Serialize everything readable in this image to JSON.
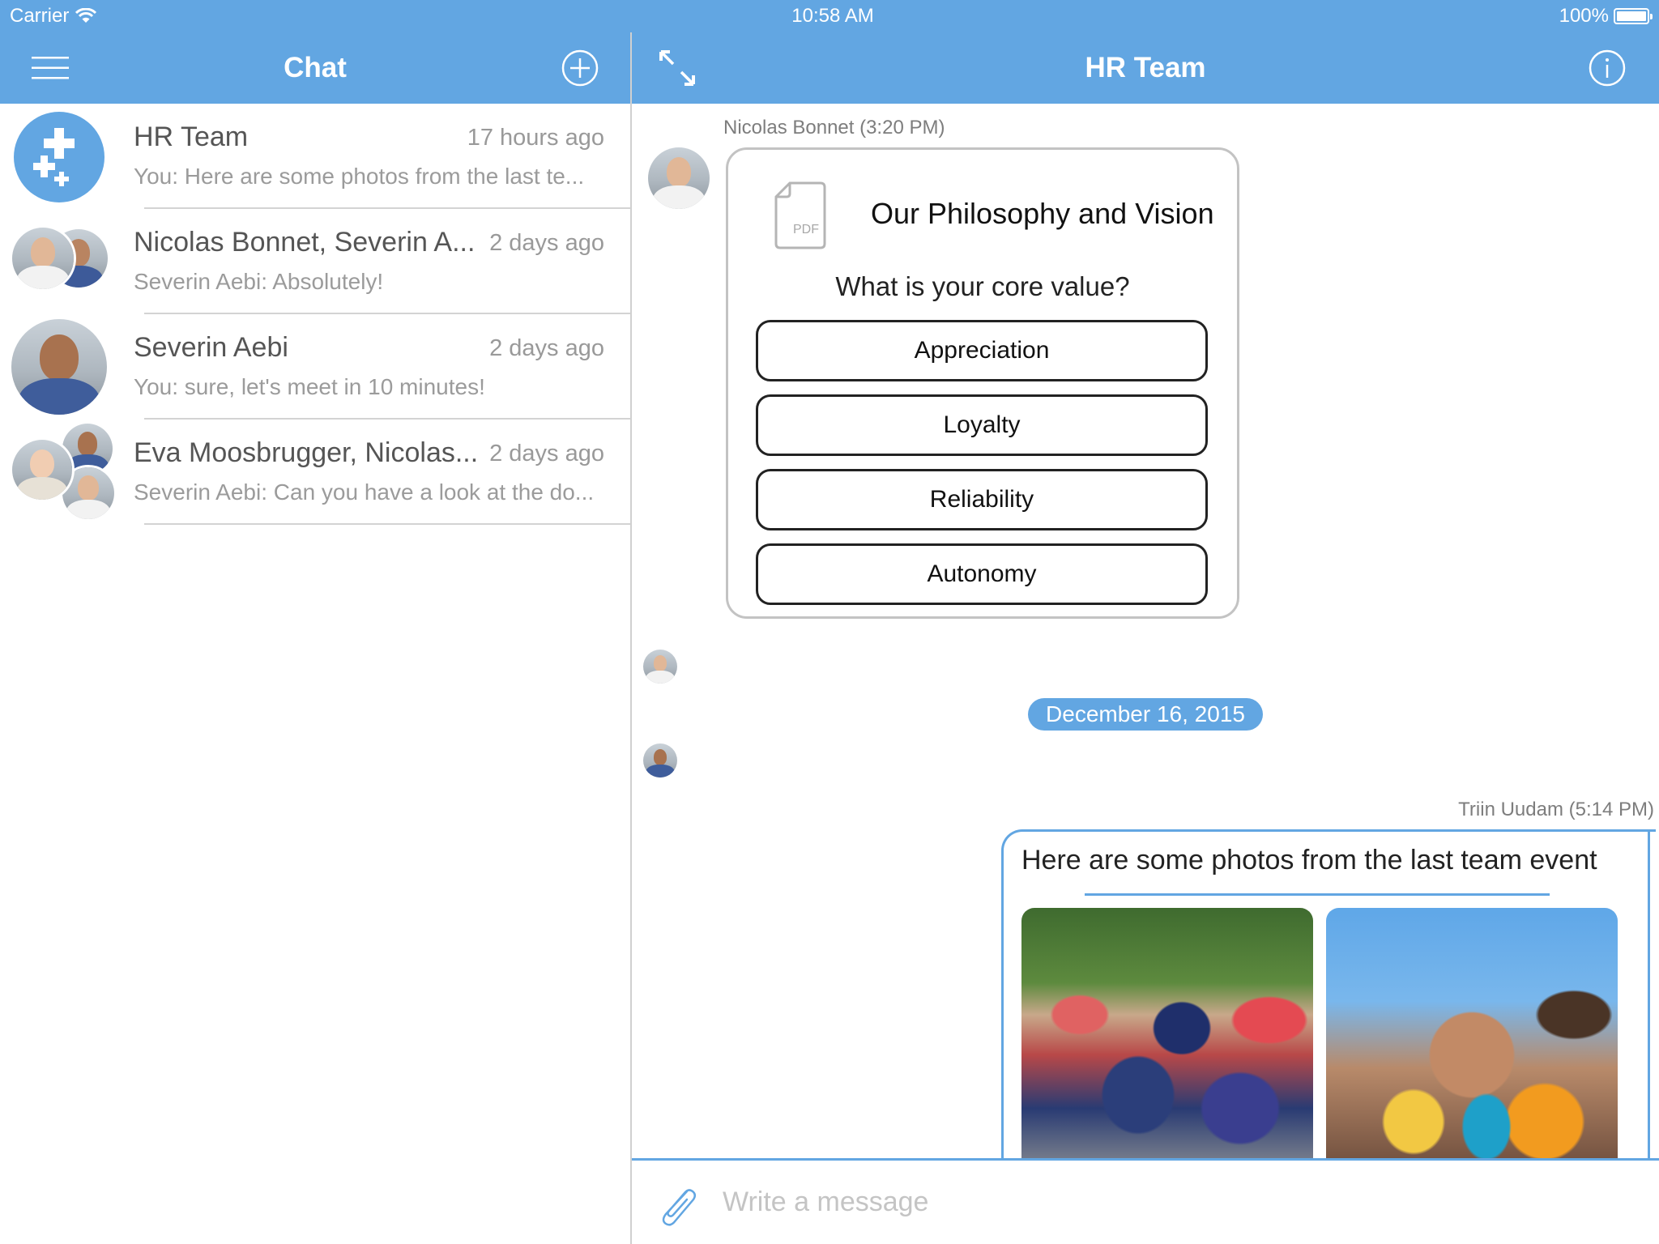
{
  "status_bar": {
    "carrier": "Carrier",
    "time": "10:58 AM",
    "battery": "100%",
    "battery_level": 1.0
  },
  "colors": {
    "accent": "#62a6e2",
    "separator": "#d3d3d3",
    "text_primary": "#555555",
    "text_secondary": "#9b9b9b"
  },
  "left_nav": {
    "title": "Chat",
    "menu_icon": "hamburger-icon",
    "new_icon": "plus-circle-icon"
  },
  "right_nav": {
    "title": "HR Team",
    "expand_icon": "expand-arrows-icon",
    "info_icon": "info-circle-icon"
  },
  "conversations": [
    {
      "name": "HR Team",
      "time": "17 hours ago",
      "preview": "You: Here are some photos from the last te...",
      "avatar": "group-plus-icon"
    },
    {
      "name": "Nicolas Bonnet, Severin A...",
      "time": "2 days ago",
      "preview": "Severin Aebi: Absolutely!",
      "avatar": "two-person-avatar"
    },
    {
      "name": "Severin Aebi",
      "time": "2 days ago",
      "preview": "You: sure, let's meet in 10 minutes!",
      "avatar": "person-avatar"
    },
    {
      "name": "Eva Moosbrugger, Nicolas...",
      "time": "2 days ago",
      "preview": "Severin Aebi: Can you have a look at the do...",
      "avatar": "three-person-avatar"
    }
  ],
  "messages": {
    "poll": {
      "sender_meta": "Nicolas Bonnet (3:20 PM)",
      "document_type": "PDF",
      "document_title": "Our Philosophy and Vision",
      "question": "What is your core value?",
      "options": [
        "Appreciation",
        "Loyalty",
        "Reliability",
        "Autonomy"
      ]
    },
    "date_separator": "December 16, 2015",
    "own_message": {
      "sender_meta": "Triin Uudam (5:14 PM)",
      "text": "Here are some photos from the last team event",
      "photos": [
        "team-event-photo-1",
        "team-event-photo-2"
      ]
    }
  },
  "composer": {
    "placeholder": "Write a message",
    "value": "",
    "attach_icon": "paperclip-icon"
  }
}
